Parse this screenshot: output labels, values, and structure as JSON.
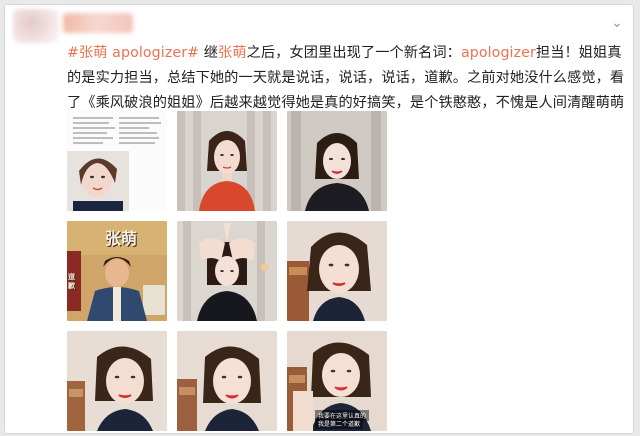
{
  "post": {
    "segments": [
      {
        "t": "#张萌 apologizer#",
        "link": true
      },
      {
        "t": " 继",
        "link": false
      },
      {
        "t": "张萌",
        "link": true
      },
      {
        "t": "之后，女团里出现了一个新名词：",
        "link": false
      },
      {
        "t": "apologizer",
        "link": true
      },
      {
        "t": "担当！姐姐真的是实力担当，总结下她的一天就是说话，说话，说话，道歉。之前对她没什么感觉，看了《乘风破浪的姐姐》后越来越觉得她是真的好搞笑，是个铁憨憨，不愧是人间清醒萌萌姐啦！",
        "link": false
      }
    ]
  },
  "tiles": [
    {
      "kind": "document-screenshot"
    },
    {
      "kind": "portrait-red-top"
    },
    {
      "kind": "portrait-dark-top"
    },
    {
      "kind": "poster-illustration",
      "poster_text": "张萌",
      "poster_side": "道歉"
    },
    {
      "kind": "hands-on-head"
    },
    {
      "kind": "closeup-vanity"
    },
    {
      "kind": "closeup-left"
    },
    {
      "kind": "closeup-center"
    },
    {
      "kind": "closeup-captioned",
      "caption_line1": "我要在这里认真的",
      "caption_line2": "我是第二个道歉"
    }
  ],
  "colors": {
    "link": "#eb7350",
    "text": "#222222"
  }
}
